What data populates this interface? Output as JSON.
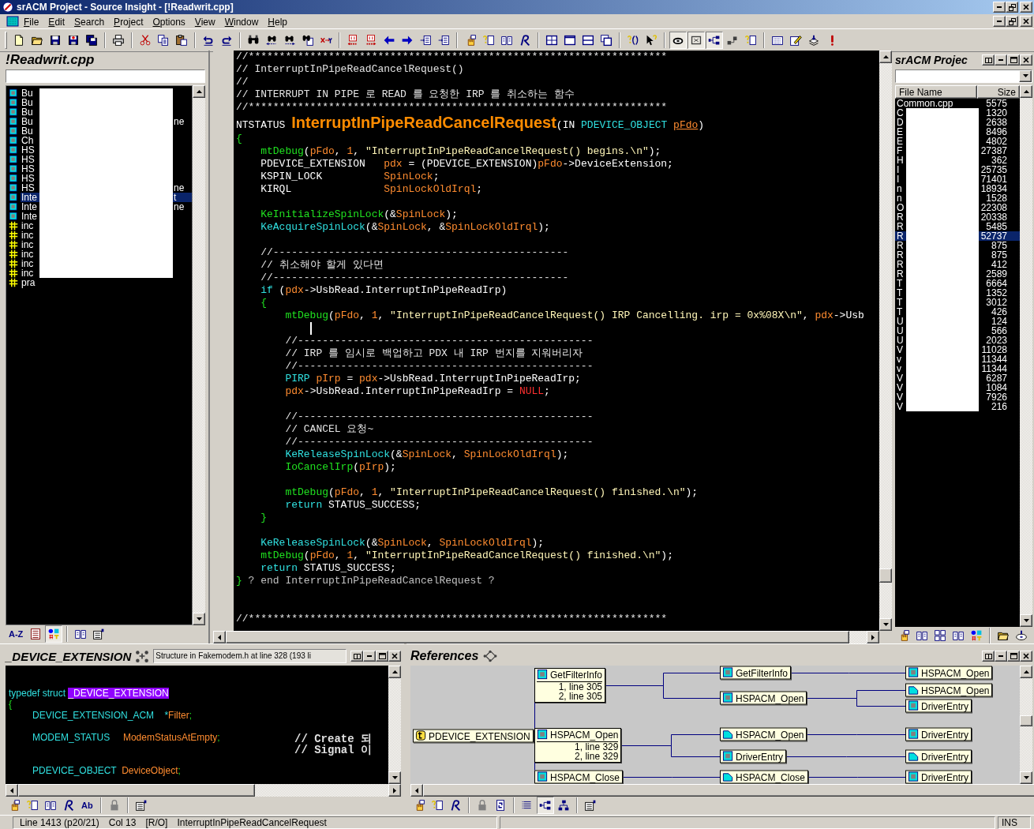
{
  "window": {
    "title": "srACM Project - Source Insight - [!Readwrit.cpp]"
  },
  "menu": [
    "File",
    "Edit",
    "Search",
    "Project",
    "Options",
    "View",
    "Window",
    "Help"
  ],
  "toolbar": {
    "toggles": [
      {
        "on": true
      },
      {
        "on": true
      },
      {
        "on": true
      },
      {
        "on": false
      },
      {
        "on": false
      }
    ]
  },
  "symbol_panel": {
    "title": "!Readwrit.cpp",
    "sort_label": "A-Z",
    "toggles": [
      {
        "on": false
      },
      {
        "on": true
      }
    ],
    "rows": [
      {
        "kind": "function",
        "text": "Bu",
        "selected": false
      },
      {
        "kind": "function",
        "text": "Bu",
        "selected": false
      },
      {
        "kind": "function",
        "text": "Bu",
        "selected": false
      },
      {
        "kind": "function",
        "text": "Bu",
        "tail": "ne",
        "selected": false
      },
      {
        "kind": "function",
        "text": "Bu",
        "selected": false
      },
      {
        "kind": "function",
        "text": "Ch",
        "selected": false
      },
      {
        "kind": "function",
        "text": "HS",
        "selected": false
      },
      {
        "kind": "function",
        "text": "HS",
        "selected": false
      },
      {
        "kind": "function",
        "text": "HS",
        "selected": false
      },
      {
        "kind": "function",
        "text": "HS",
        "selected": false
      },
      {
        "kind": "function",
        "text": "HS",
        "tail": "ne",
        "selected": false
      },
      {
        "kind": "function",
        "text": "Inte",
        "tail": "t",
        "selected": true
      },
      {
        "kind": "function",
        "text": "Inte",
        "tail": "ne",
        "selected": false
      },
      {
        "kind": "function",
        "text": "Inte",
        "selected": false
      },
      {
        "kind": "macro",
        "text": "inc",
        "selected": false
      },
      {
        "kind": "macro",
        "text": "inc",
        "selected": false
      },
      {
        "kind": "macro",
        "text": "inc",
        "selected": false
      },
      {
        "kind": "macro",
        "text": "inc",
        "selected": false
      },
      {
        "kind": "macro",
        "text": "inc",
        "selected": false
      },
      {
        "kind": "macro",
        "text": "inc",
        "selected": false
      },
      {
        "kind": "macro",
        "text": "pra",
        "selected": false
      }
    ]
  },
  "editor": {
    "lines": [
      {
        "kind": "code",
        "segments": [
          {
            "kind": "comment",
            "text": "//********************************************************************"
          }
        ]
      },
      {
        "kind": "code",
        "segments": [
          {
            "kind": "comment",
            "text": "// InterruptInPipeReadCancelRequest()"
          }
        ]
      },
      {
        "kind": "code",
        "segments": [
          {
            "kind": "comment",
            "text": "//"
          }
        ]
      },
      {
        "kind": "code",
        "segments": [
          {
            "kind": "comment",
            "text": "// INTERRUPT IN PIPE 로 READ 를 요청한 IRP 를 취소하는 함수"
          }
        ]
      },
      {
        "kind": "code",
        "segments": [
          {
            "kind": "comment",
            "text": "//********************************************************************"
          }
        ]
      },
      {
        "kind": "code",
        "segments": [
          {
            "kind": "type",
            "text": "NTSTATUS "
          },
          {
            "kind": "decl",
            "text": "InterruptInPipeReadCancelRequest"
          },
          {
            "kind": "plain",
            "text": "(IN "
          },
          {
            "kind": "keyword",
            "text": "PDEVICE_OBJECT "
          },
          {
            "kind": "param",
            "text": "pFdo"
          },
          {
            "kind": "plain",
            "text": ")"
          }
        ]
      },
      {
        "kind": "code",
        "segments": [
          {
            "kind": "brace",
            "text": "{"
          }
        ]
      },
      {
        "kind": "code",
        "segments": [
          {
            "kind": "call",
            "text": "    mtDebug"
          },
          {
            "kind": "plain",
            "text": "("
          },
          {
            "kind": "var",
            "text": "pFdo"
          },
          {
            "kind": "plain",
            "text": ", "
          },
          {
            "kind": "number",
            "text": "1"
          },
          {
            "kind": "plain",
            "text": ", "
          },
          {
            "kind": "string",
            "text": "\"InterruptInPipeReadCancelRequest() begins.\\n\""
          },
          {
            "kind": "plain",
            "text": ");"
          }
        ]
      },
      {
        "kind": "code",
        "segments": [
          {
            "kind": "type",
            "text": "    PDEVICE_EXTENSION   "
          },
          {
            "kind": "var",
            "text": "pdx"
          },
          {
            "kind": "plain",
            "text": " = (PDEVICE_EXTENSION)"
          },
          {
            "kind": "var",
            "text": "pFdo"
          },
          {
            "kind": "plain",
            "text": "->DeviceExtension;"
          }
        ]
      },
      {
        "kind": "code",
        "segments": [
          {
            "kind": "type",
            "text": "    KSPIN_LOCK          "
          },
          {
            "kind": "var",
            "text": "SpinLock"
          },
          {
            "kind": "plain",
            "text": ";"
          }
        ]
      },
      {
        "kind": "code",
        "segments": [
          {
            "kind": "type",
            "text": "    KIRQL               "
          },
          {
            "kind": "var",
            "text": "SpinLockOldIrql"
          },
          {
            "kind": "plain",
            "text": ";"
          }
        ]
      },
      {
        "kind": "blank"
      },
      {
        "kind": "code",
        "segments": [
          {
            "kind": "call",
            "text": "    KeInitializeSpinLock"
          },
          {
            "kind": "plain",
            "text": "(&"
          },
          {
            "kind": "var",
            "text": "SpinLock"
          },
          {
            "kind": "plain",
            "text": ");"
          }
        ]
      },
      {
        "kind": "code",
        "segments": [
          {
            "kind": "api",
            "text": "    KeAcquireSpinLock"
          },
          {
            "kind": "plain",
            "text": "(&"
          },
          {
            "kind": "var",
            "text": "SpinLock"
          },
          {
            "kind": "plain",
            "text": ", &"
          },
          {
            "kind": "var",
            "text": "SpinLockOldIrql"
          },
          {
            "kind": "plain",
            "text": ");"
          }
        ]
      },
      {
        "kind": "blank"
      },
      {
        "kind": "code",
        "segments": [
          {
            "kind": "comment",
            "text": "    //------------------------------------------------"
          }
        ]
      },
      {
        "kind": "code",
        "segments": [
          {
            "kind": "comment",
            "text": "    // 취소해야 할게 있다면"
          }
        ]
      },
      {
        "kind": "code",
        "segments": [
          {
            "kind": "comment",
            "text": "    //------------------------------------------------"
          }
        ]
      },
      {
        "kind": "code",
        "segments": [
          {
            "kind": "keyword",
            "text": "    if"
          },
          {
            "kind": "plain",
            "text": " ("
          },
          {
            "kind": "var",
            "text": "pdx"
          },
          {
            "kind": "plain",
            "text": "->UsbRead.InterruptInPipeReadIrp)"
          }
        ]
      },
      {
        "kind": "code",
        "segments": [
          {
            "kind": "brace",
            "text": "    {"
          }
        ]
      },
      {
        "kind": "code",
        "segments": [
          {
            "kind": "call",
            "text": "        mtDebug"
          },
          {
            "kind": "plain",
            "text": "("
          },
          {
            "kind": "var",
            "text": "pFdo"
          },
          {
            "kind": "plain",
            "text": ", "
          },
          {
            "kind": "number",
            "text": "1"
          },
          {
            "kind": "plain",
            "text": ", "
          },
          {
            "kind": "string",
            "text": "\"InterruptInPipeReadCancelRequest() IRP Cancelling. irp = 0x%08X\\n\""
          },
          {
            "kind": "plain",
            "text": ", "
          },
          {
            "kind": "var",
            "text": "pdx"
          },
          {
            "kind": "plain",
            "text": "->Usb"
          }
        ]
      },
      {
        "kind": "cursor"
      },
      {
        "kind": "code",
        "segments": [
          {
            "kind": "comment",
            "text": "        //------------------------------------------------"
          }
        ]
      },
      {
        "kind": "code",
        "segments": [
          {
            "kind": "comment",
            "text": "        // IRP 를 임시로 백업하고 PDX 내 IRP 번지를 지워버리자"
          }
        ]
      },
      {
        "kind": "code",
        "segments": [
          {
            "kind": "comment",
            "text": "        //------------------------------------------------"
          }
        ]
      },
      {
        "kind": "code",
        "segments": [
          {
            "kind": "keyword",
            "text": "        PIRP "
          },
          {
            "kind": "var",
            "text": "pIrp"
          },
          {
            "kind": "plain",
            "text": " = "
          },
          {
            "kind": "var",
            "text": "pdx"
          },
          {
            "kind": "plain",
            "text": "->UsbRead.InterruptInPipeReadIrp;"
          }
        ]
      },
      {
        "kind": "code",
        "segments": [
          {
            "kind": "var",
            "text": "        pdx"
          },
          {
            "kind": "plain",
            "text": "->UsbRead.InterruptInPipeReadIrp = "
          },
          {
            "kind": "null",
            "text": "NULL"
          },
          {
            "kind": "plain",
            "text": ";"
          }
        ]
      },
      {
        "kind": "blank"
      },
      {
        "kind": "code",
        "segments": [
          {
            "kind": "comment",
            "text": "        //------------------------------------------------"
          }
        ]
      },
      {
        "kind": "code",
        "segments": [
          {
            "kind": "comment",
            "text": "        // CANCEL 요청~"
          }
        ]
      },
      {
        "kind": "code",
        "segments": [
          {
            "kind": "comment",
            "text": "        //------------------------------------------------"
          }
        ]
      },
      {
        "kind": "code",
        "segments": [
          {
            "kind": "api",
            "text": "        KeReleaseSpinLock"
          },
          {
            "kind": "plain",
            "text": "(&"
          },
          {
            "kind": "var",
            "text": "SpinLock"
          },
          {
            "kind": "plain",
            "text": ", "
          },
          {
            "kind": "var",
            "text": "SpinLockOldIrql"
          },
          {
            "kind": "plain",
            "text": ");"
          }
        ]
      },
      {
        "kind": "code",
        "segments": [
          {
            "kind": "call",
            "text": "        IoCancelIrp"
          },
          {
            "kind": "plain",
            "text": "("
          },
          {
            "kind": "var",
            "text": "pIrp"
          },
          {
            "kind": "plain",
            "text": ");"
          }
        ]
      },
      {
        "kind": "blank"
      },
      {
        "kind": "code",
        "segments": [
          {
            "kind": "call",
            "text": "        mtDebug"
          },
          {
            "kind": "plain",
            "text": "("
          },
          {
            "kind": "var",
            "text": "pFdo"
          },
          {
            "kind": "plain",
            "text": ", "
          },
          {
            "kind": "number",
            "text": "1"
          },
          {
            "kind": "plain",
            "text": ", "
          },
          {
            "kind": "string",
            "text": "\"InterruptInPipeReadCancelRequest() finished.\\n\""
          },
          {
            "kind": "plain",
            "text": ");"
          }
        ]
      },
      {
        "kind": "code",
        "segments": [
          {
            "kind": "keyword",
            "text": "        return"
          },
          {
            "kind": "plain",
            "text": " STATUS_SUCCESS;"
          }
        ]
      },
      {
        "kind": "code",
        "segments": [
          {
            "kind": "brace",
            "text": "    }"
          }
        ]
      },
      {
        "kind": "blank"
      },
      {
        "kind": "code",
        "segments": [
          {
            "kind": "api",
            "text": "    KeReleaseSpinLock"
          },
          {
            "kind": "plain",
            "text": "(&"
          },
          {
            "kind": "var",
            "text": "SpinLock"
          },
          {
            "kind": "plain",
            "text": ", "
          },
          {
            "kind": "var",
            "text": "SpinLockOldIrql"
          },
          {
            "kind": "plain",
            "text": ");"
          }
        ]
      },
      {
        "kind": "code",
        "segments": [
          {
            "kind": "call",
            "text": "    mtDebug"
          },
          {
            "kind": "plain",
            "text": "("
          },
          {
            "kind": "var",
            "text": "pFdo"
          },
          {
            "kind": "plain",
            "text": ", "
          },
          {
            "kind": "number",
            "text": "1"
          },
          {
            "kind": "plain",
            "text": ", "
          },
          {
            "kind": "string",
            "text": "\"InterruptInPipeReadCancelRequest() finished.\\n\""
          },
          {
            "kind": "plain",
            "text": ");"
          }
        ]
      },
      {
        "kind": "code",
        "segments": [
          {
            "kind": "keyword",
            "text": "    return"
          },
          {
            "kind": "plain",
            "text": " STATUS_SUCCESS;"
          }
        ]
      },
      {
        "kind": "code",
        "segments": [
          {
            "kind": "brace",
            "text": "}"
          },
          {
            "kind": "end",
            "text": " ? end InterruptInPipeReadCancelRequest ?"
          }
        ]
      },
      {
        "kind": "blank"
      },
      {
        "kind": "blank"
      },
      {
        "kind": "code",
        "segments": [
          {
            "kind": "comment",
            "text": "//********************************************************************"
          }
        ]
      }
    ]
  },
  "project_panel": {
    "title": "srACM Projec",
    "columns": [
      "File Name",
      "Size"
    ],
    "rows": [
      {
        "name": "Common.cpp",
        "size": "5575",
        "selected": false
      },
      {
        "name": "C",
        "size": "1320",
        "selected": false
      },
      {
        "name": "D",
        "size": "2638",
        "selected": false
      },
      {
        "name": "E",
        "size": "8496",
        "selected": false
      },
      {
        "name": "E",
        "size": "4802",
        "selected": false
      },
      {
        "name": "F",
        "size": "27387",
        "selected": false
      },
      {
        "name": "H",
        "size": "362",
        "selected": false
      },
      {
        "name": "I",
        "size": "25735",
        "selected": false
      },
      {
        "name": "I",
        "size": "71401",
        "selected": false
      },
      {
        "name": "n",
        "size": "18934",
        "selected": false
      },
      {
        "name": "n",
        "size": "1528",
        "selected": false
      },
      {
        "name": "O",
        "size": "22308",
        "selected": false
      },
      {
        "name": "R",
        "size": "20338",
        "selected": false
      },
      {
        "name": "R",
        "size": "5485",
        "selected": false
      },
      {
        "name": "R",
        "size": "52737",
        "selected": true
      },
      {
        "name": "R",
        "size": "875",
        "selected": false
      },
      {
        "name": "R",
        "size": "875",
        "selected": false
      },
      {
        "name": "R",
        "size": "412",
        "selected": false
      },
      {
        "name": "R",
        "size": "2589",
        "selected": false
      },
      {
        "name": "T",
        "size": "6664",
        "selected": false
      },
      {
        "name": "T",
        "size": "1352",
        "selected": false
      },
      {
        "name": "T",
        "size": "3012",
        "selected": false
      },
      {
        "name": "T",
        "size": "426",
        "selected": false
      },
      {
        "name": "U",
        "size": "124",
        "selected": false
      },
      {
        "name": "U",
        "size": "566",
        "selected": false
      },
      {
        "name": "U",
        "size": "2023",
        "selected": false
      },
      {
        "name": "V",
        "size": "11028",
        "selected": false
      },
      {
        "name": "v",
        "size": "11344",
        "selected": false
      },
      {
        "name": "v",
        "size": "11344",
        "selected": false
      },
      {
        "name": "V",
        "size": "6287",
        "selected": false
      },
      {
        "name": "V",
        "size": "1084",
        "selected": false
      },
      {
        "name": "V",
        "size": "7926",
        "selected": false
      },
      {
        "name": "V",
        "size": "216",
        "selected": false
      }
    ]
  },
  "context_panel": {
    "title": "_DEVICE_EXTENSION",
    "info": "Structure in Fakemodem.h at line 328 (193 li",
    "toolbar_label": "Ab",
    "lines": [
      {
        "kind": "code",
        "segments": [
          {
            "kind": "keyword",
            "text": "typedef struct "
          },
          {
            "kind": "highlight",
            "text": "_DEVICE_EXTENSION"
          }
        ]
      },
      {
        "kind": "code",
        "segments": [
          {
            "kind": "brace",
            "text": "{"
          }
        ]
      },
      {
        "kind": "code",
        "segments": [
          {
            "kind": "keyword",
            "text": "         DEVICE_EXTENSION_ACM    *"
          },
          {
            "kind": "var",
            "text": "Filter"
          },
          {
            "kind": "brace",
            "text": ";"
          }
        ]
      },
      {
        "kind": "blank"
      },
      {
        "kind": "code",
        "segments": [
          {
            "kind": "keyword",
            "text": "         MODEM_STATUS     "
          },
          {
            "kind": "var",
            "text": "ModemStatusAtEmpty"
          },
          {
            "kind": "brace",
            "text": ";"
          }
        ],
        "comment": "// Create 되"
      },
      {
        "kind": "code",
        "comment": "// Signal 이"
      },
      {
        "kind": "blank"
      },
      {
        "kind": "code",
        "segments": [
          {
            "kind": "keyword",
            "text": "         PDEVICE_OBJECT  "
          },
          {
            "kind": "var",
            "text": "DeviceObject"
          },
          {
            "kind": "brace",
            "text": ";"
          }
        ]
      }
    ]
  },
  "references": {
    "title": "References",
    "toggles": [
      {
        "on": false
      },
      {
        "on": true
      },
      {
        "on": false
      }
    ],
    "tree": {
      "kind": "type",
      "name": "PDEVICE_EXTENSION",
      "children": [
        {
          "kind": "function",
          "name": "GetFilterInfo",
          "refs": [
            "1, line 305",
            "2, line 305"
          ],
          "children": [
            {
              "kind": "function",
              "name": "GetFilterInfo",
              "children": [
                {
                  "kind": "function",
                  "name": "HSPACM_Open"
                }
              ]
            },
            {
              "kind": "function",
              "name": "HSPACM_Open",
              "children": [
                {
                  "kind": "prototype",
                  "name": "HSPACM_Open"
                },
                {
                  "kind": "function",
                  "name": "DriverEntry"
                }
              ]
            }
          ]
        },
        {
          "kind": "function",
          "name": "HSPACM_Open",
          "refs": [
            "1, line 329",
            "2, line 329"
          ],
          "children": [
            {
              "kind": "prototype",
              "name": "HSPACM_Open",
              "children": [
                {
                  "kind": "function",
                  "name": "DriverEntry"
                }
              ]
            },
            {
              "kind": "function",
              "name": "DriverEntry",
              "children": [
                {
                  "kind": "prototype",
                  "name": "DriverEntry"
                }
              ]
            }
          ]
        },
        {
          "kind": "function",
          "name": "HSPACM_Close",
          "children": [
            {
              "kind": "prototype",
              "name": "HSPACM_Close",
              "children": [
                {
                  "kind": "function",
                  "name": "DriverEntry"
                }
              ]
            }
          ]
        }
      ]
    }
  },
  "status_bar": {
    "fields": [
      "Line 1413 (p20/21)",
      "Col 13",
      "[R/O]",
      "InterruptInPipeReadCancelRequest"
    ],
    "mode": "INS"
  }
}
